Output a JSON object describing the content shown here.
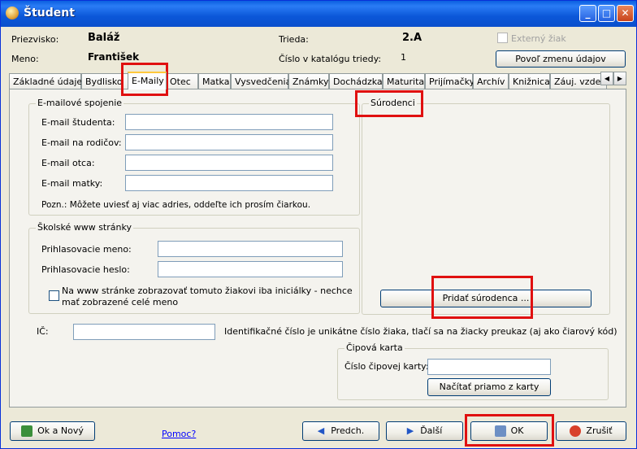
{
  "window": {
    "title": "Študent",
    "buttons": {
      "minimize": "_",
      "maximize": "□",
      "close": "✕"
    }
  },
  "header": {
    "surname_label": "Priezvisko:",
    "surname_value": "Baláž",
    "name_label": "Meno:",
    "name_value": "František",
    "class_label": "Trieda:",
    "class_value": "2.A",
    "catalog_label": "Číslo v katalógu triedy:",
    "catalog_value": "1",
    "external_label": "Externý žiak",
    "allow_change_label": "Povoľ zmenu údajov"
  },
  "tabs": [
    {
      "label": "Základné údaje"
    },
    {
      "label": "Bydlisko"
    },
    {
      "label": "E-Maily"
    },
    {
      "label": "Otec"
    },
    {
      "label": "Matka"
    },
    {
      "label": "Vysvedčenia"
    },
    {
      "label": "Známky"
    },
    {
      "label": "Dochádzka"
    },
    {
      "label": "Maturita"
    },
    {
      "label": "Prijímačky"
    },
    {
      "label": "Archív"
    },
    {
      "label": "Knižnica"
    },
    {
      "label": "Záuj. vzdel"
    }
  ],
  "email_group": {
    "title": "E-mailové spojenie",
    "student_label": "E-mail študenta:",
    "parents_label": "E-mail na rodičov:",
    "father_label": "E-mail otca:",
    "mother_label": "E-mail matky:",
    "note": "Pozn.: Môžete uviesť aj viac adries, oddeľte ich prosím čiarkou."
  },
  "web_group": {
    "title": "Školské www stránky",
    "login_label": "Prihlasovacie meno:",
    "password_label": "Prihlasovacie heslo:",
    "initials_line1": "Na www stránke zobrazovať tomuto žiakovi iba iniciálky - nechce",
    "initials_line2": "mať zobrazené celé meno"
  },
  "siblings_group": {
    "title": "Súrodenci",
    "add_button": "Pridať súrodenca ..."
  },
  "ic": {
    "label": "IČ:",
    "note": "Identifikačné číslo je unikátne číslo žiaka, tlačí sa na žiacky preukaz (aj ako čiarový kód)"
  },
  "chip_group": {
    "title": "Čipová karta",
    "number_label": "Číslo čipovej karty:",
    "load_button": "Načítať priamo z karty"
  },
  "footer": {
    "ok_new": "Ok a Nový",
    "help": "Pomoc?",
    "prev": "Predch.",
    "next": "Ďalší",
    "ok": "OK",
    "cancel": "Zrušiť"
  },
  "colors": {
    "highlight": "#e01010",
    "title_bar": "#0a5fe0"
  }
}
